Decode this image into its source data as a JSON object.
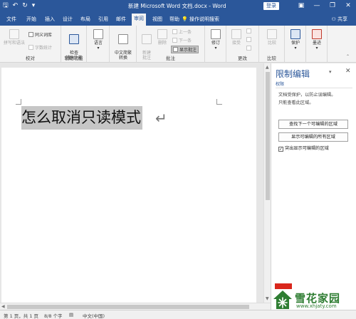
{
  "window": {
    "title": "新建 Microsoft Word 文档.docx - Word",
    "login_label": "登录",
    "minimize_glyph": "—",
    "restore_glyph": "❐",
    "close_glyph": "✕"
  },
  "quick_access": {
    "save_glyph": "🖫",
    "undo_glyph": "↶",
    "redo_glyph": "↻",
    "customize_glyph": "▾"
  },
  "tabs": [
    {
      "label": "文件"
    },
    {
      "label": "开始"
    },
    {
      "label": "插入"
    },
    {
      "label": "设计"
    },
    {
      "label": "布局"
    },
    {
      "label": "引用"
    },
    {
      "label": "邮件"
    },
    {
      "label": "审阅",
      "active": true
    },
    {
      "label": "视图"
    },
    {
      "label": "帮助"
    }
  ],
  "tell_me": {
    "icon": "lightbulb-icon",
    "label": "操作说明搜索"
  },
  "share": {
    "icon": "person-icon",
    "label": "共享"
  },
  "ribbon": {
    "proofing": {
      "label": "校对",
      "spelling": "拼写和语法",
      "thesaurus": "同义词库",
      "word_count": "字数统计"
    },
    "accessibility": {
      "label": "辅助功能",
      "check": "检查\n辅助功能"
    },
    "language": {
      "label": "",
      "language": "语言"
    },
    "chinese": {
      "label": "",
      "convert": "中文简繁\n转换"
    },
    "comments": {
      "label": "批注",
      "new_comment": "新建\n批注",
      "delete": "删除",
      "previous": "上一条",
      "next": "下一条",
      "show_comments": "显示批注"
    },
    "tracking": {
      "label": "",
      "track_changes": "修订"
    },
    "changes": {
      "label": "更改",
      "accept": "接受"
    },
    "compare": {
      "label": "比较",
      "compare": "比较"
    },
    "protect": {
      "label": "",
      "protect": "保护"
    },
    "ink": {
      "label": "",
      "ink": "墨迹"
    }
  },
  "document": {
    "text": "怎么取消只读模式",
    "para_mark": "↵"
  },
  "pane": {
    "title": "限制编辑",
    "subtitle": "权限",
    "desc_line1": "文档受保护，以防止误编辑。",
    "desc_line2": "只能查看此区域。",
    "find_next_button": "查找下一个可编辑的区域",
    "show_all_button": "显示可编辑的所有区域",
    "highlight_check": "突出显示可编辑的区域",
    "highlight_checked": true
  },
  "watermark": {
    "name": "雪花家园",
    "url": "www.xhjaty.com"
  },
  "status": {
    "page": "第 1 页，共 1 页",
    "words": "8/8 个字",
    "language": "中文(中国)"
  },
  "colors": {
    "brand": "#2b579a",
    "ribbon_bg": "#f3f3f3",
    "watermark_green": "#2e7d32",
    "watermark_red": "#d9261c"
  }
}
